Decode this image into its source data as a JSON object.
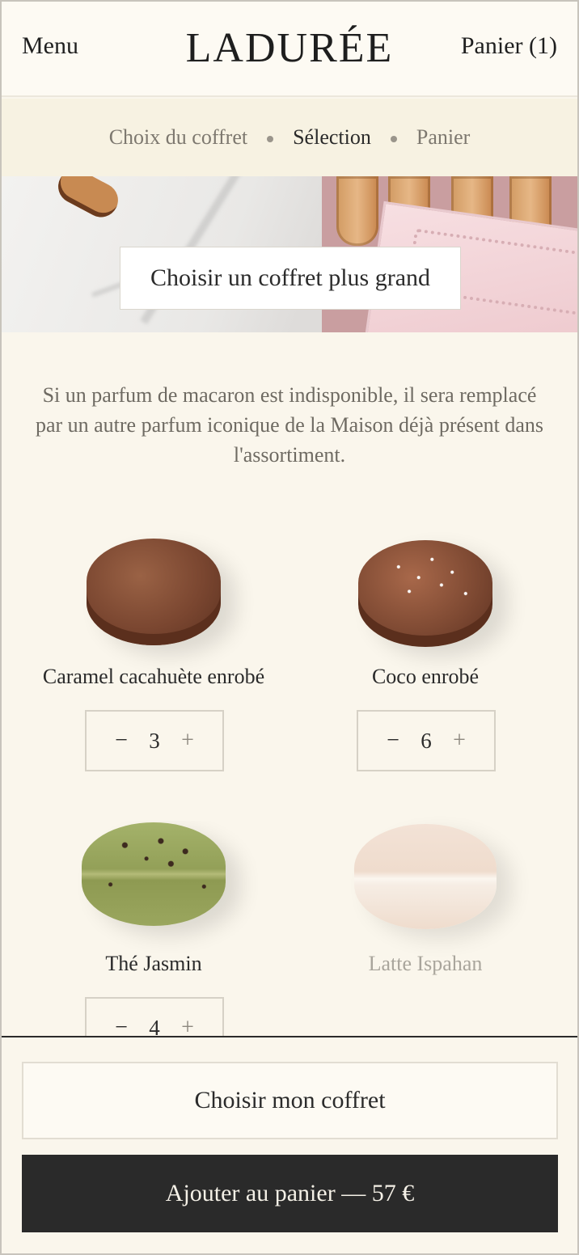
{
  "header": {
    "menu_label": "Menu",
    "logo_text": "LADURÉE",
    "cart_label": "Panier (1)"
  },
  "steps": [
    {
      "label": "Choix du coffret",
      "active": false
    },
    {
      "label": "Sélection",
      "active": true
    },
    {
      "label": "Panier",
      "active": false
    }
  ],
  "banner": {
    "button_label": "Choisir un coffret plus grand"
  },
  "notice": "Si un parfum de macaron est indisponible, il sera remplacé par un autre parfum iconique de la Maison déjà présent dans l'assortiment.",
  "products": [
    {
      "name": "Caramel cacahuète enrobé",
      "quantity": "3",
      "minus": "−",
      "plus": "+",
      "available": true
    },
    {
      "name": "Coco enrobé",
      "quantity": "6",
      "minus": "−",
      "plus": "+",
      "available": true
    },
    {
      "name": "Thé Jasmin",
      "quantity": "4",
      "minus": "−",
      "plus": "+",
      "available": true
    },
    {
      "name": "Latte Ispahan",
      "available": false
    }
  ],
  "actions": {
    "choose_label": "Choisir mon coffret",
    "add_label": "Ajouter au panier — 57 €"
  },
  "colors": {
    "background": "#faf6ec",
    "dark_button": "#2a2a2a",
    "muted_text": "#a9a59c"
  }
}
